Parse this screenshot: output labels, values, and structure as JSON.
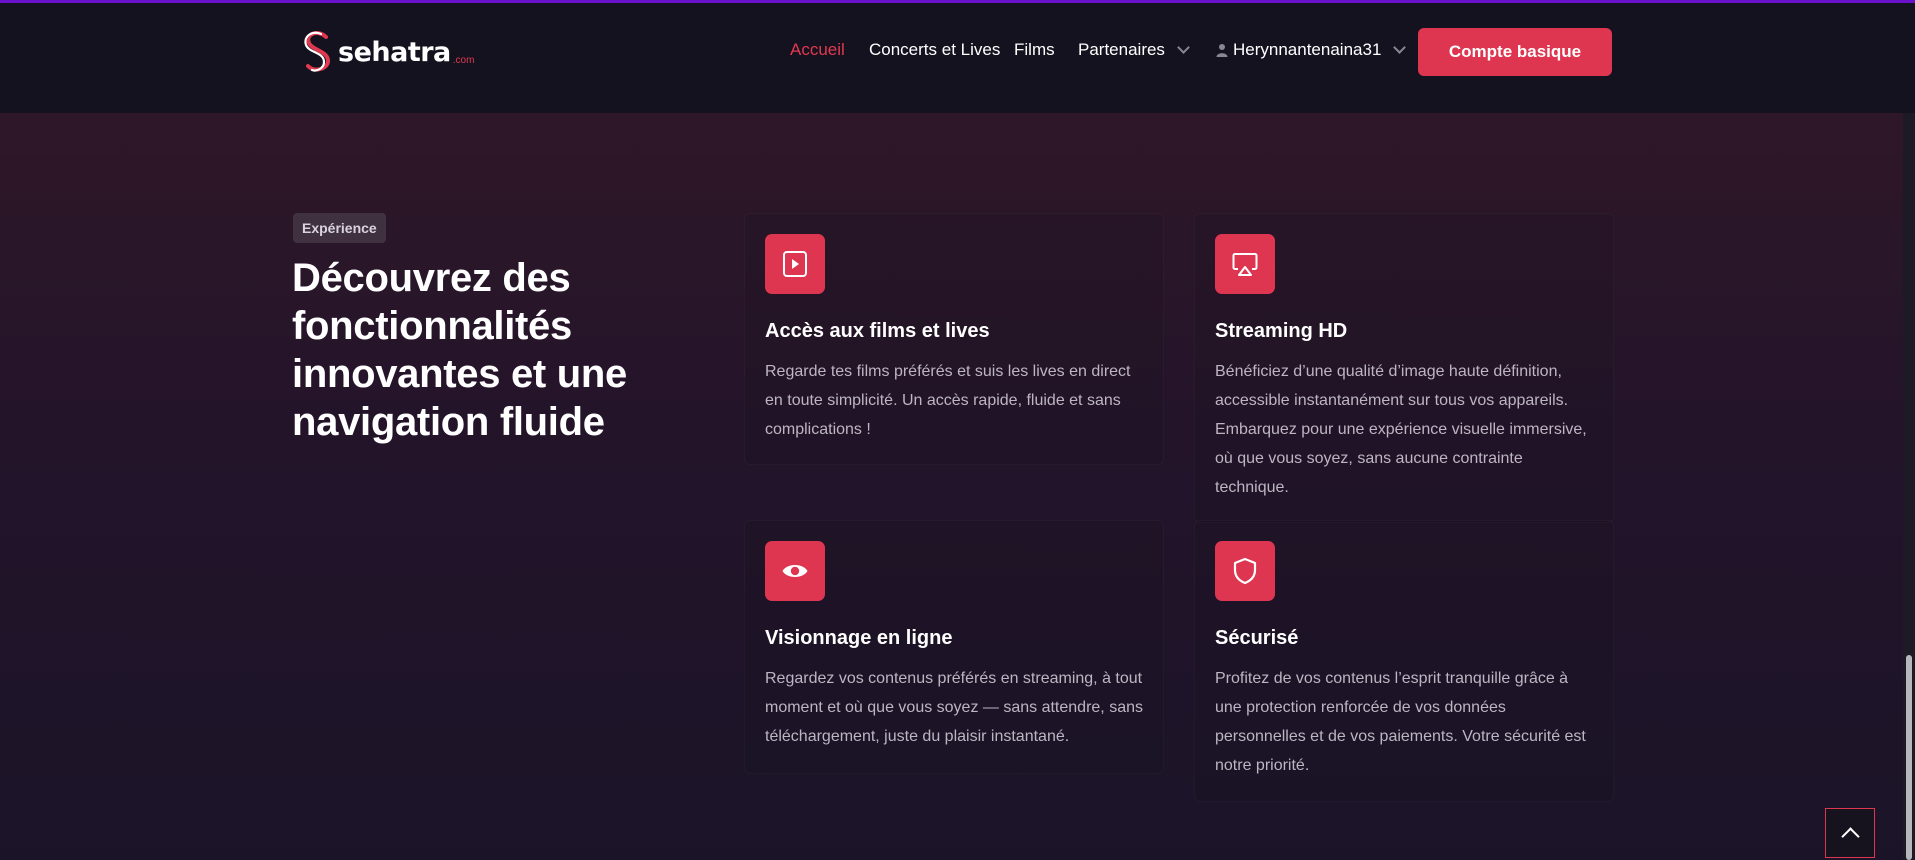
{
  "header": {
    "logo": {
      "text": "sehatra",
      "domain": ".com"
    },
    "nav": [
      {
        "label": "Accueil",
        "active": true
      },
      {
        "label": "Concerts et Lives"
      },
      {
        "label": "Films"
      },
      {
        "label": "Partenaires",
        "dropdown": true
      }
    ],
    "user": {
      "name": "Herynnantenaina31",
      "icon": "user-icon"
    },
    "cta_label": "Compte basique"
  },
  "section": {
    "badge": "Expérience",
    "title": "Découvrez des fonctionnalités innovantes et une navigation fluide",
    "features": [
      {
        "icon": "play-square-icon",
        "title": "Accès aux films et lives",
        "text": "Regarde tes films préférés et suis les lives en direct en toute simplicité. Un accès rapide, fluide et sans complications !"
      },
      {
        "icon": "airplay-icon",
        "title": "Streaming HD",
        "text": "Bénéficiez d’une qualité d’image haute définition, accessible instantanément sur tous vos appareils. Embarquez pour une expérience visuelle immersive, où que vous soyez, sans aucune contrainte technique."
      },
      {
        "icon": "eye-icon",
        "title": "Visionnage en ligne",
        "text": "Regardez vos contenus préférés en streaming, à tout moment et où que vous soyez — sans attendre, sans téléchargement, juste du plaisir instantané."
      },
      {
        "icon": "shield-icon",
        "title": "Sécurisé",
        "text": "Profitez de vos contenus l’esprit tranquille grâce à une protection renforcée de vos données personnelles et de vos paiements. Votre sécurité est notre priorité."
      }
    ]
  },
  "colors": {
    "accent": "#de3651",
    "topline": "#6a12c9",
    "header_bg": "#15121f"
  },
  "scroll_top": {
    "icon": "chevron-up-icon"
  }
}
